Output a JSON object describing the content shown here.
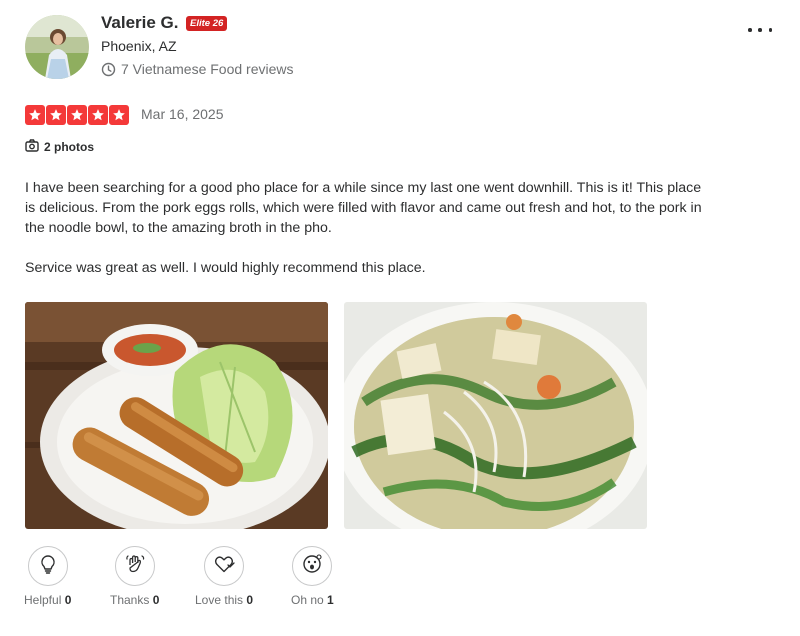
{
  "user": {
    "name": "Valerie G.",
    "elite_badge": "Elite 26",
    "location": "Phoenix, AZ",
    "review_stat": "7 Vietnamese Food reviews",
    "stat_icon": "clock-icon"
  },
  "menu": {
    "icon": "more-horizontal-icon"
  },
  "review": {
    "rating": 5,
    "max_rating": 5,
    "star_color": "#f43939",
    "date": "Mar 16, 2025",
    "photos_label": "2 photos",
    "paragraphs": [
      "I have been searching for a good pho place for a while since my last one went downhill. This is it! This place is delicious. From the pork eggs rolls, which were filled with flavor and came out fresh and hot, to the pork in the noodle bowl, to the amazing broth in the pho.",
      "Service was great as well. I would highly recommend this place."
    ]
  },
  "reactions": [
    {
      "label": "Helpful",
      "count": "0",
      "icon": "lightbulb-icon"
    },
    {
      "label": "Thanks",
      "count": "0",
      "icon": "waving-hand-icon"
    },
    {
      "label": "Love this",
      "count": "0",
      "icon": "heart-icon"
    },
    {
      "label": "Oh no",
      "count": "1",
      "icon": "surprised-face-icon"
    }
  ],
  "colors": {
    "brand_red": "#d32323",
    "text_primary": "#2d2e2f",
    "text_secondary": "#6e7072"
  }
}
